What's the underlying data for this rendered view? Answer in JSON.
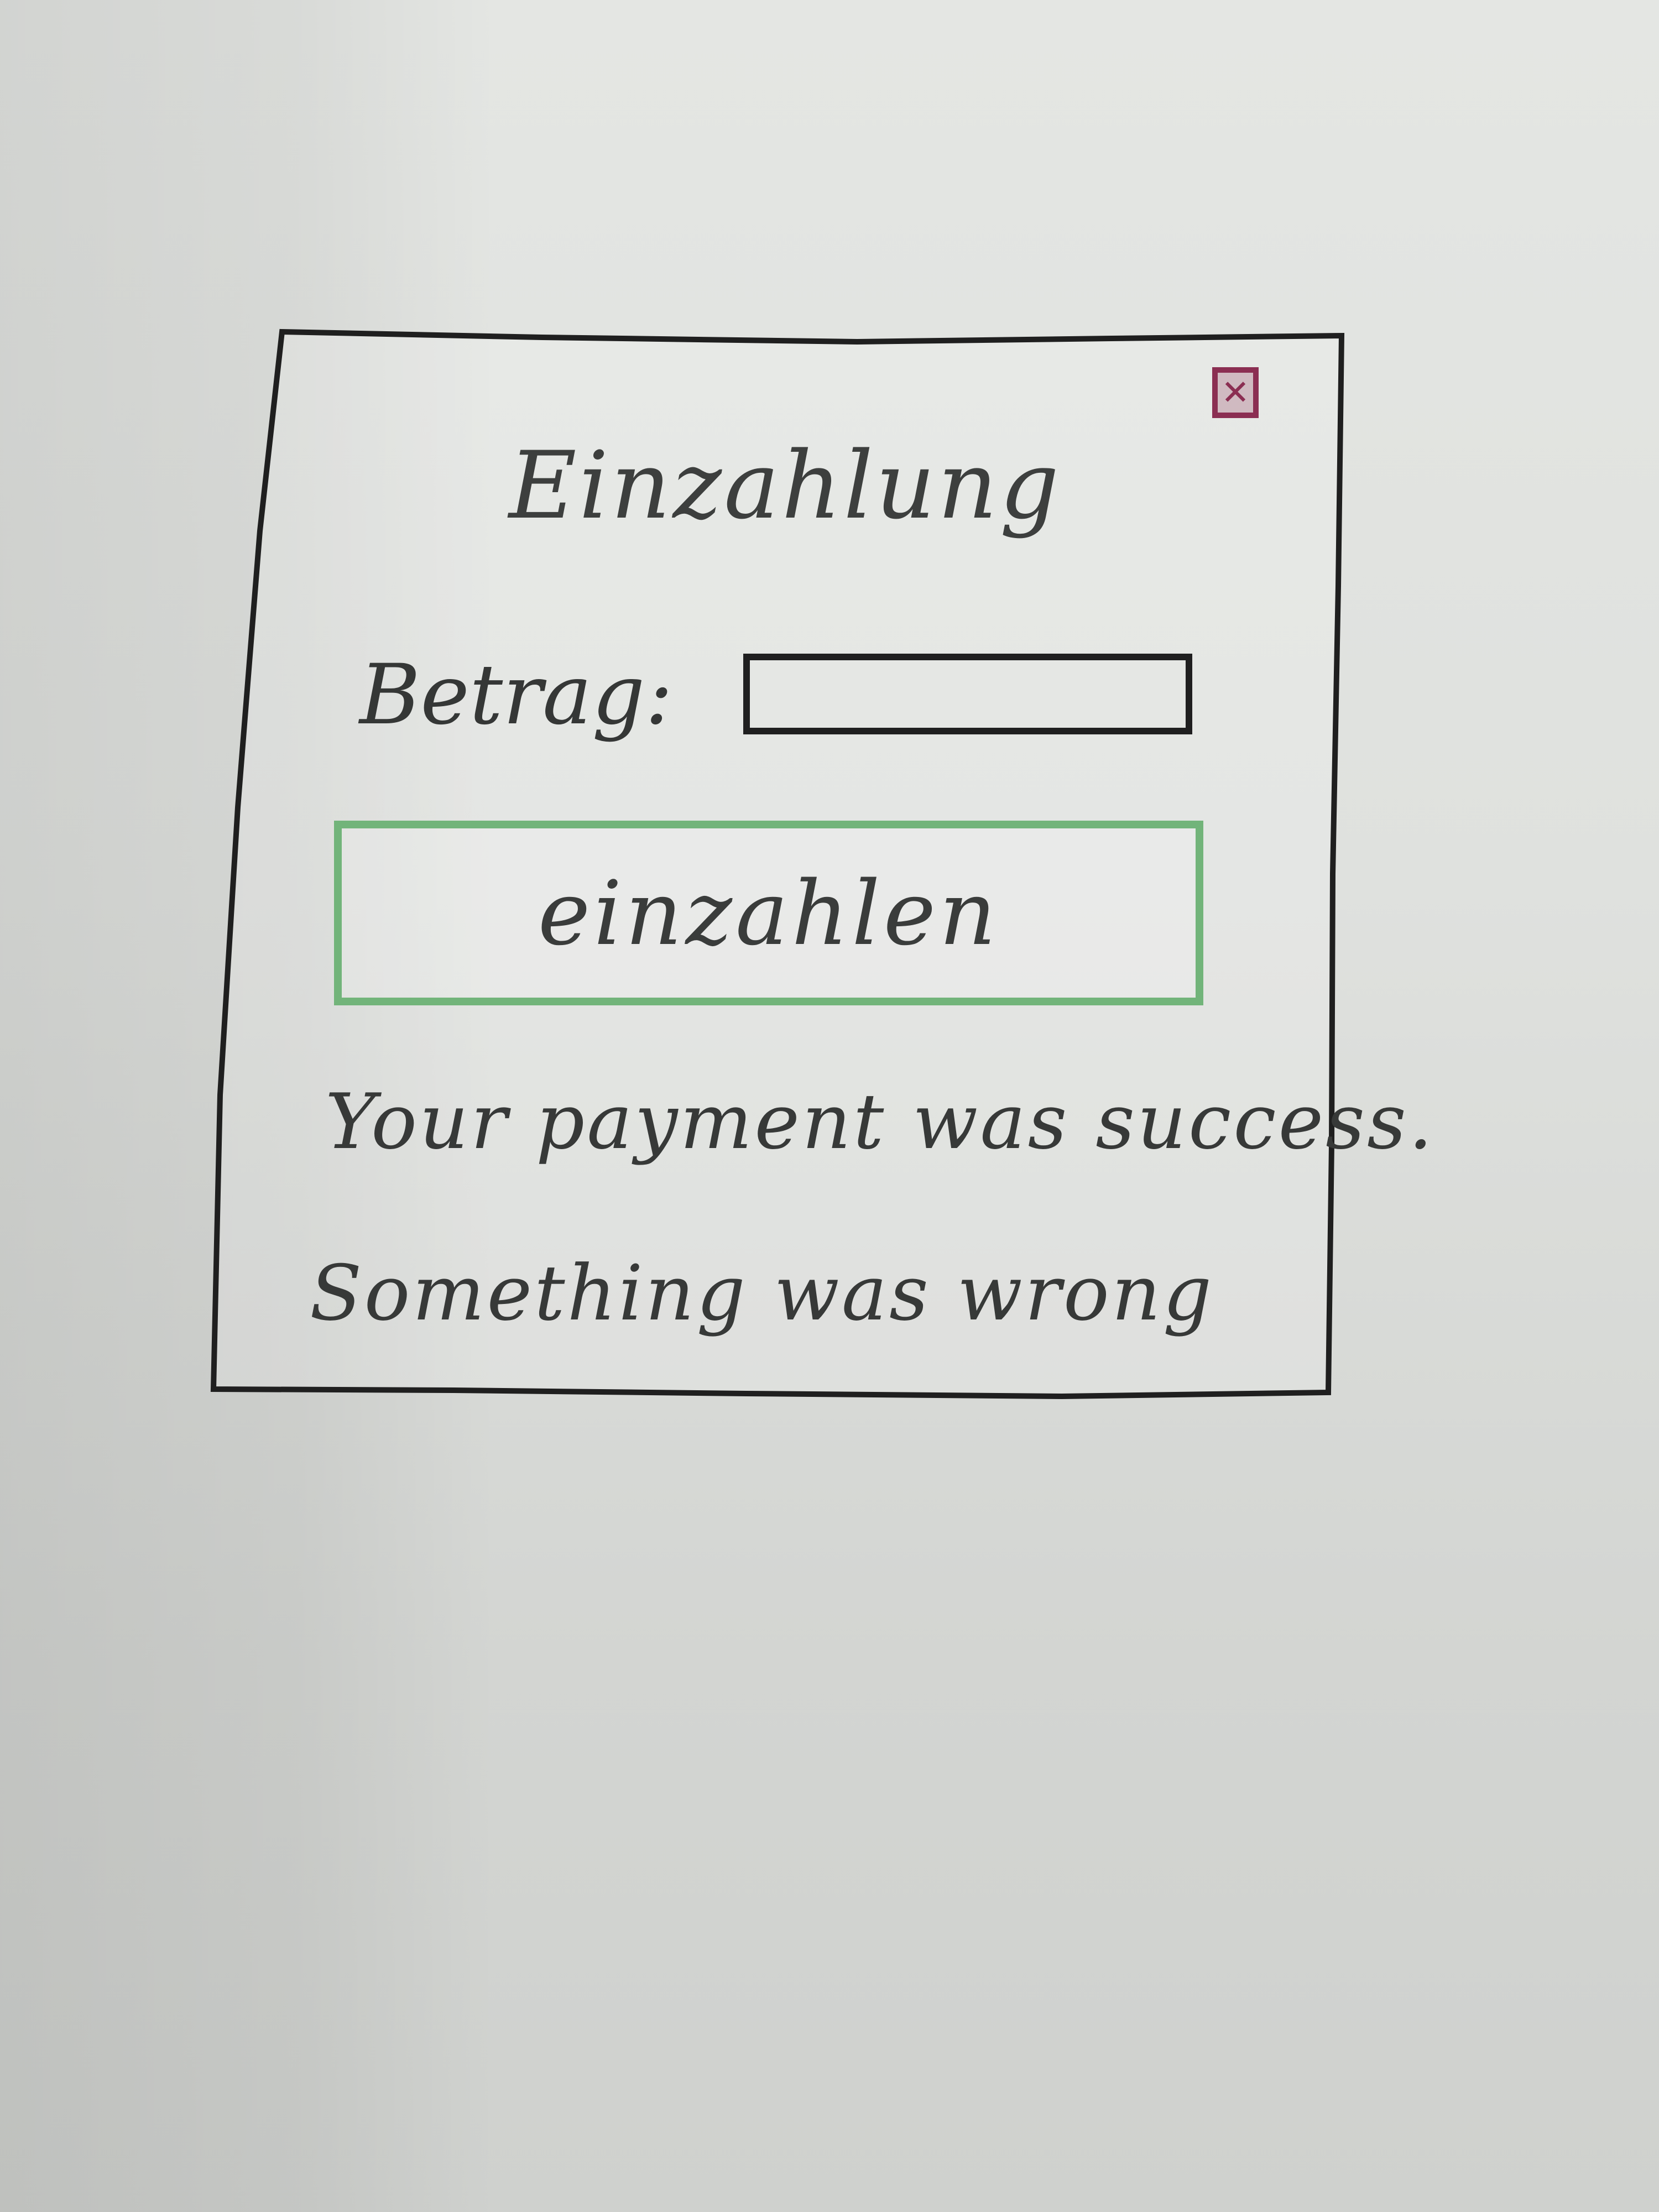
{
  "dialog": {
    "title": "Einzahlung",
    "close_icon": "close-icon",
    "amount_label": "Betrag:",
    "amount_value": "",
    "amount_placeholder": "",
    "deposit_button": "einzahlen",
    "success_message": "Your payment was success.",
    "error_message": "Something was wrong"
  },
  "colors": {
    "border": "#1f1f1f",
    "button_border": "#72b47a",
    "close_icon": "#8b2e52",
    "text": "#373938"
  }
}
